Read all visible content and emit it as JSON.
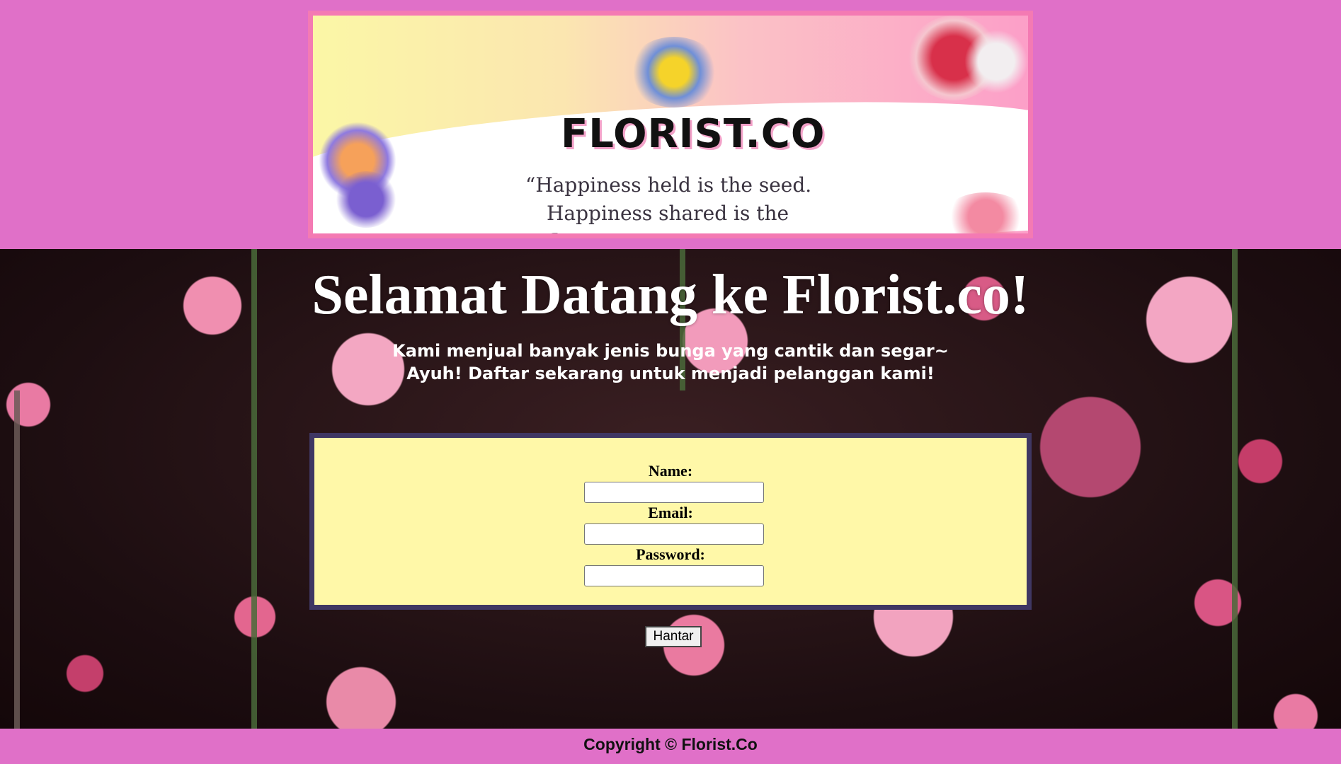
{
  "colors": {
    "page_background": "#e070c8",
    "banner_border": "#f47ab3",
    "form_background": "#fff8a8",
    "form_border": "#3f3763"
  },
  "banner": {
    "logo_text": "FLORIST.CO",
    "quote_line1": "“Happiness held is the seed.",
    "quote_line2": "Happiness shared is the flower.”"
  },
  "main": {
    "title": "Selamat Datang ke Florist.co!",
    "subtitle_line1": "Kami menjual banyak jenis bunga yang cantik dan segar~",
    "subtitle_line2": "Ayuh! Daftar sekarang untuk menjadi pelanggan kami!"
  },
  "form": {
    "name_label": "Name:",
    "name_value": "",
    "email_label": "Email:",
    "email_value": "",
    "password_label": "Password:",
    "password_value": "",
    "submit_label": "Hantar"
  },
  "footer": {
    "copyright": "Copyright © Florist.Co"
  }
}
